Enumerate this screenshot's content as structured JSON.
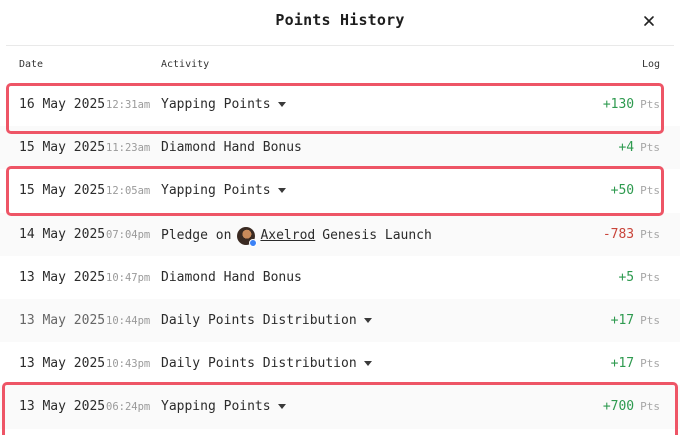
{
  "modal": {
    "title": "Points History",
    "close_glyph": "✕"
  },
  "columns": {
    "date": "Date",
    "activity": "Activity",
    "log": "Log"
  },
  "rows": [
    {
      "date": "16 May 2025",
      "time": "12:31am",
      "activity": "Yapping Points",
      "has_caret": true,
      "points": "+130",
      "unit": "Pts",
      "sign": "pos",
      "highlighted": true
    },
    {
      "date": "15 May 2025",
      "time": "11:23am",
      "activity": "Diamond Hand Bonus",
      "has_caret": false,
      "points": "+4",
      "unit": "Pts",
      "sign": "pos",
      "highlighted": false
    },
    {
      "date": "15 May 2025",
      "time": "12:05am",
      "activity": "Yapping Points",
      "has_caret": true,
      "points": "+50",
      "unit": "Pts",
      "sign": "pos",
      "highlighted": true
    },
    {
      "date": "14 May 2025",
      "time": "07:04pm",
      "activity_prefix": "Pledge on",
      "activity_link": "Axelrod",
      "activity_suffix": "Genesis Launch",
      "has_caret": false,
      "points": "-783",
      "unit": "Pts",
      "sign": "neg",
      "highlighted": false
    },
    {
      "date": "13 May 2025",
      "time": "10:47pm",
      "activity": "Diamond Hand Bonus",
      "has_caret": false,
      "points": "+5",
      "unit": "Pts",
      "sign": "pos",
      "highlighted": false
    },
    {
      "date": "13 May 2025",
      "time": "10:44pm",
      "activity": "Daily Points Distribution",
      "has_caret": true,
      "points": "+17",
      "unit": "Pts",
      "sign": "pos",
      "highlighted": false
    },
    {
      "date": "13 May 2025",
      "time": "10:43pm",
      "activity": "Daily Points Distribution",
      "has_caret": true,
      "points": "+17",
      "unit": "Pts",
      "sign": "pos",
      "highlighted": false
    },
    {
      "date": "13 May 2025",
      "time": "06:24pm",
      "activity": "Yapping Points",
      "has_caret": true,
      "points": "+700",
      "unit": "Pts",
      "sign": "pos",
      "highlighted": true
    }
  ],
  "colors": {
    "positive": "#2e9a4f",
    "negative": "#c9443a",
    "highlight": "#ee5566"
  }
}
